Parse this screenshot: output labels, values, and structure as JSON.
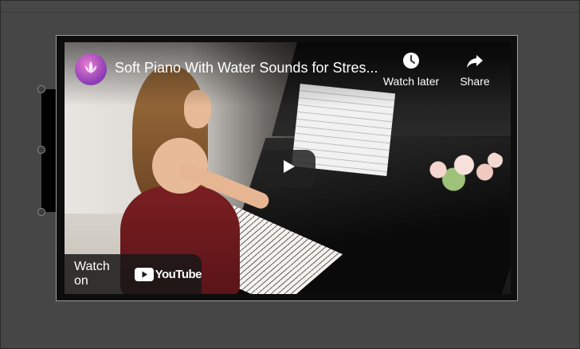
{
  "video": {
    "title": "Soft Piano With Water Sounds for Stres...",
    "actions": {
      "watch_later_label": "Watch later",
      "share_label": "Share"
    },
    "watch_on_label": "Watch on",
    "platform_name": "YouTube"
  },
  "icons": {
    "channel": "lotus-icon",
    "watch_later": "clock-icon",
    "share": "share-arrow-icon",
    "play": "play-icon",
    "logo": "youtube-logo-icon"
  },
  "colors": {
    "background": "#464646",
    "youtube_red": "#ff0000",
    "play_button": "#212121"
  }
}
